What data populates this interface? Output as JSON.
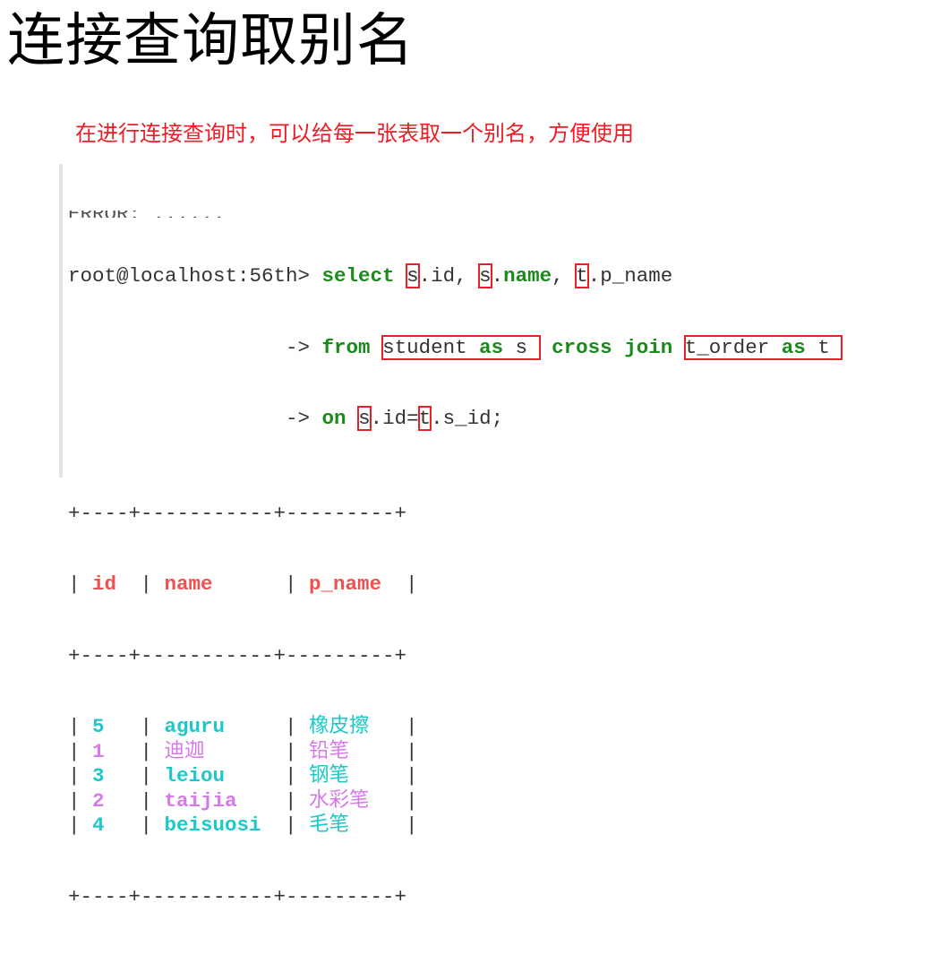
{
  "slide": {
    "title": "连接查询取别名",
    "note": "在进行连接查询时，可以给每一张表取一个别名，方便使用"
  },
  "terminal": {
    "partial_line": "ERROR: ......",
    "prompt": "root@localhost:56th> ",
    "continuation": "                  -> ",
    "query": {
      "line1": {
        "kw_select": "select",
        "alias1": "s",
        "part1": ".id, ",
        "alias2": "s",
        "part2": ".",
        "kw_name": "name",
        "part3": ", ",
        "alias3": "t",
        "part4": ".p_name"
      },
      "line2": {
        "kw_from": "from",
        "table1": "student ",
        "kw_as1": "as",
        "alias_s": " s",
        "kw_cross": "cross",
        "kw_join": "join",
        "table2": "t_order ",
        "kw_as2": "as",
        "alias_t": " t"
      },
      "line3": {
        "kw_on": "on",
        "alias_s": "s",
        "part1": ".id=",
        "alias_t": "t",
        "part2": ".s_id;"
      }
    },
    "table": {
      "border": "+----+-----------+---------+",
      "headers": [
        "id",
        "name",
        "p_name"
      ],
      "rows": [
        {
          "id": "5",
          "name": "aguru",
          "p_name": "橡皮擦",
          "color": "teal",
          "name_cjk": false
        },
        {
          "id": "1",
          "name": "迪迦",
          "p_name": "铅笔",
          "color": "violet",
          "name_cjk": true
        },
        {
          "id": "3",
          "name": "leiou",
          "p_name": "钢笔",
          "color": "teal",
          "name_cjk": false
        },
        {
          "id": "2",
          "name": "taijia",
          "p_name": "水彩笔",
          "color": "violet",
          "name_cjk": false
        },
        {
          "id": "4",
          "name": "beisuosi",
          "p_name": "毛笔",
          "color": "teal",
          "name_cjk": false
        }
      ]
    }
  },
  "colors": {
    "note_red": "#ec1c24",
    "keyword_green": "#1a8a1a",
    "header_red": "#f05050",
    "row_teal": "#1ec8c8",
    "row_violet": "#d57ae8",
    "highlight_box": "#e8202a"
  }
}
